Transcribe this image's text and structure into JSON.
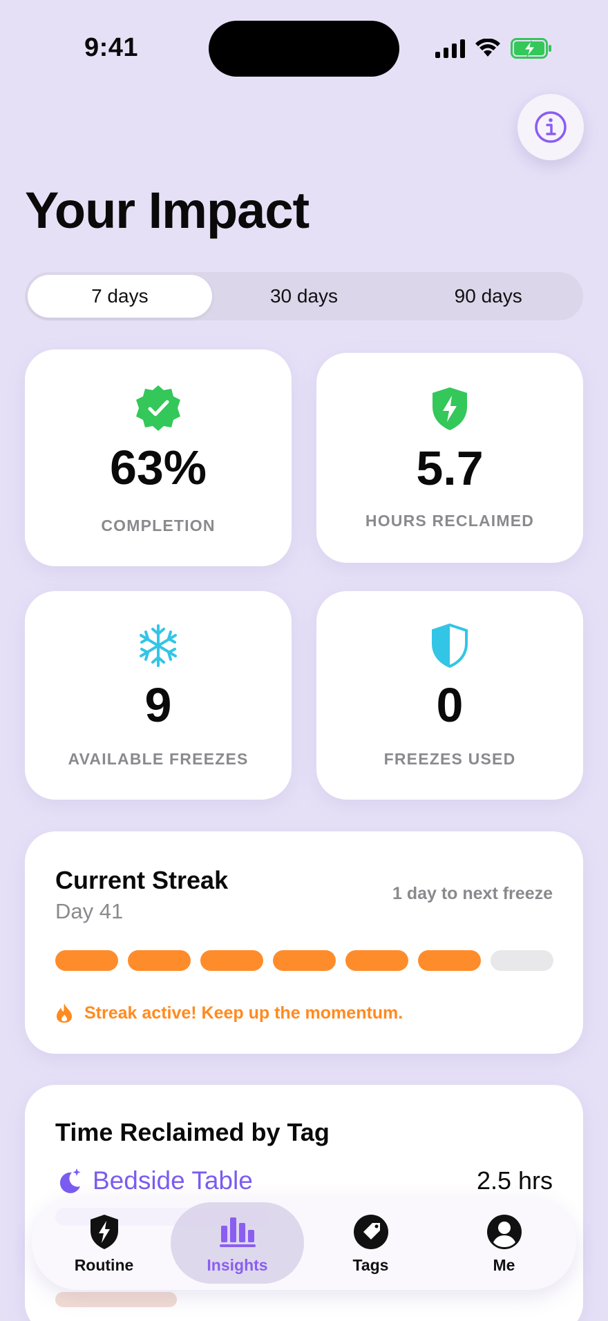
{
  "status_bar": {
    "time": "9:41"
  },
  "header": {
    "title": "Your Impact"
  },
  "range_tabs": [
    {
      "label": "7 days",
      "active": true
    },
    {
      "label": "30 days",
      "active": false
    },
    {
      "label": "90 days",
      "active": false
    }
  ],
  "stats": [
    {
      "icon": "verified-badge-icon",
      "value": "63%",
      "label": "COMPLETION",
      "color": "#34c759"
    },
    {
      "icon": "shield-bolt-icon",
      "value": "5.7",
      "label": "HOURS RECLAIMED",
      "color": "#34c759"
    },
    {
      "icon": "snowflake-icon",
      "value": "9",
      "label": "AVAILABLE FREEZES",
      "color": "#32c5e6"
    },
    {
      "icon": "half-shield-icon",
      "value": "0",
      "label": "FREEZES USED",
      "color": "#32c5e6"
    }
  ],
  "streak": {
    "title": "Current Streak",
    "day": "Day 41",
    "next_freeze": "1 day to next freeze",
    "segments_filled": 6,
    "segments_total": 7,
    "message": "Streak active! Keep up the momentum.",
    "accent": "#ff8c2a"
  },
  "time_by_tag": {
    "title": "Time Reclaimed by Tag",
    "items": [
      {
        "name": "Bedside Table",
        "hours": "2.5 hrs",
        "icon": "moon-stars-icon",
        "color": "#7b5cf0"
      }
    ]
  },
  "tab_bar": [
    {
      "label": "Routine",
      "icon": "shield-bolt-icon",
      "active": false
    },
    {
      "label": "Insights",
      "icon": "bar-chart-icon",
      "active": true
    },
    {
      "label": "Tags",
      "icon": "tag-icon",
      "active": false
    },
    {
      "label": "Me",
      "icon": "person-circle-icon",
      "active": false
    }
  ]
}
